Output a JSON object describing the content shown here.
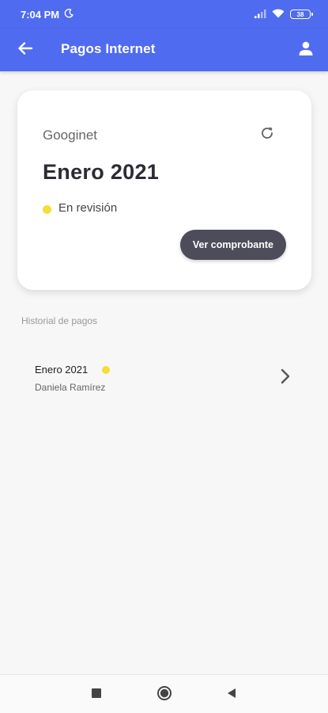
{
  "status_bar": {
    "time": "7:04 PM",
    "battery": "38",
    "icons": [
      "moon-icon",
      "signal-icon",
      "wifi-icon",
      "battery-icon"
    ]
  },
  "app_bar": {
    "title": "Pagos Internet",
    "back_icon": "arrow-left-icon",
    "account_icon": "person-icon",
    "color": "#4f6bf0"
  },
  "card": {
    "provider": "Googinet",
    "period": "Enero 2021",
    "status": "En revisión",
    "status_color": "#f5dd3a",
    "receipt_button": "Ver comprobante",
    "refresh_icon": "refresh-icon"
  },
  "history": {
    "label": "Historial de pagos",
    "items": [
      {
        "title": "Enero 2021",
        "subtitle": "Daniela Ramírez",
        "status_color": "#f5dd3a"
      }
    ]
  },
  "nav_bar": {
    "icons": [
      "recents-square-icon",
      "home-circle-icon",
      "back-triangle-icon"
    ]
  }
}
